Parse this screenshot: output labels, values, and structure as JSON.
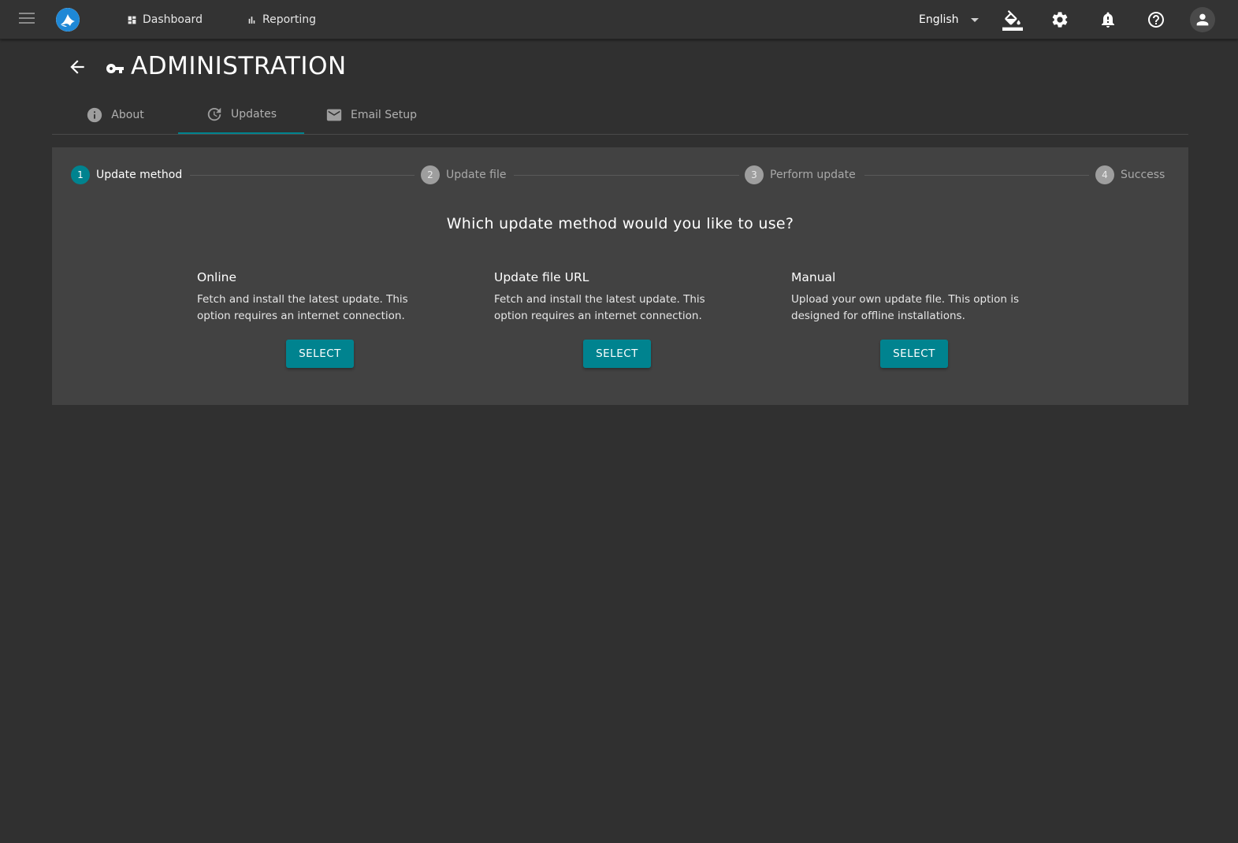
{
  "nav": {
    "dashboard": "Dashboard",
    "reporting": "Reporting",
    "language": "English"
  },
  "header": {
    "title": "ADMINISTRATION"
  },
  "tabs": [
    {
      "label": "About",
      "icon": "info-icon"
    },
    {
      "label": "Updates",
      "icon": "update-icon",
      "active": true
    },
    {
      "label": "Email Setup",
      "icon": "email-icon"
    }
  ],
  "stepper": {
    "steps": [
      {
        "number": "1",
        "label": "Update method",
        "active": true
      },
      {
        "number": "2",
        "label": "Update file"
      },
      {
        "number": "3",
        "label": "Perform update"
      },
      {
        "number": "4",
        "label": "Success"
      }
    ]
  },
  "question": "Which update method would you like to use?",
  "options": [
    {
      "title": "Online",
      "description": "Fetch and install the latest update. This option requires an internet connection.",
      "button": "SELECT"
    },
    {
      "title": "Update file URL",
      "description": "Fetch and install the latest update. This option requires an internet connection.",
      "button": "SELECT"
    },
    {
      "title": "Manual",
      "description": "Upload your own update file. This option is designed for offline installations.",
      "button": "SELECT"
    }
  ],
  "colors": {
    "accent": "#00838f",
    "background": "#303030",
    "panel": "#424242",
    "topbar": "#333333"
  }
}
